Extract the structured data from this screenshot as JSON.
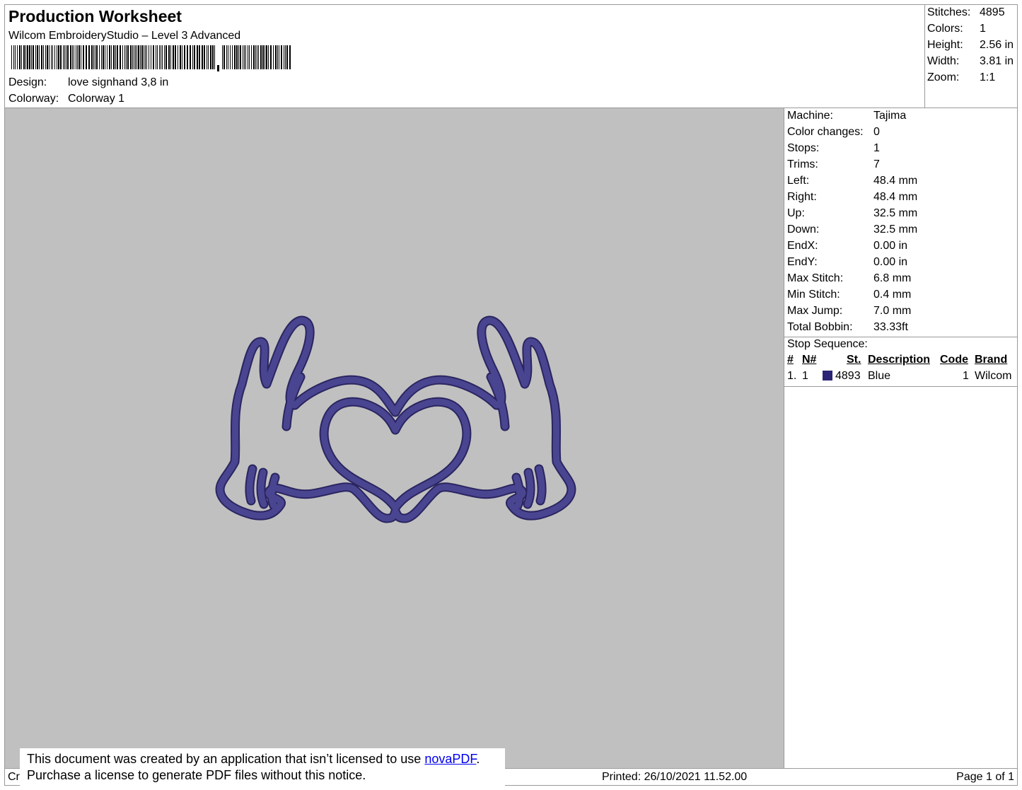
{
  "header": {
    "title": "Production Worksheet",
    "subtitle": "Wilcom EmbroideryStudio – Level 3 Advanced",
    "design_label": "Design:",
    "design_value": "love signhand 3,8 in",
    "colorway_label": "Colorway:",
    "colorway_value": "Colorway 1"
  },
  "summary": [
    {
      "label": "Stitches:",
      "value": "4895"
    },
    {
      "label": "Colors:",
      "value": "1"
    },
    {
      "label": "Height:",
      "value": "2.56 in"
    },
    {
      "label": "Width:",
      "value": "3.81 in"
    },
    {
      "label": "Zoom:",
      "value": "1:1"
    }
  ],
  "details": [
    {
      "label": "Machine:",
      "value": "Tajima"
    },
    {
      "label": "Color changes:",
      "value": "0"
    },
    {
      "label": "Stops:",
      "value": "1"
    },
    {
      "label": "Trims:",
      "value": "7"
    },
    {
      "label": "Left:",
      "value": "48.4 mm"
    },
    {
      "label": "Right:",
      "value": "48.4 mm"
    },
    {
      "label": "Up:",
      "value": "32.5 mm"
    },
    {
      "label": "Down:",
      "value": "32.5 mm"
    },
    {
      "label": "EndX:",
      "value": "0.00 in"
    },
    {
      "label": "EndY:",
      "value": "0.00 in"
    },
    {
      "label": "Max Stitch:",
      "value": "6.8 mm"
    },
    {
      "label": "Min Stitch:",
      "value": "0.4 mm"
    },
    {
      "label": "Max Jump:",
      "value": "7.0 mm"
    },
    {
      "label": "Total Bobbin:",
      "value": "33.33ft"
    }
  ],
  "stop_sequence": {
    "title": "Stop Sequence:",
    "columns": [
      "#",
      "N#",
      "St.",
      "Description",
      "Code",
      "Brand"
    ],
    "rows": [
      {
        "index": "1.",
        "n": "1",
        "color": "#2b2375",
        "stitches": "4893",
        "description": "Blue",
        "code": "1",
        "brand": "Wilcom"
      }
    ]
  },
  "design": {
    "thread_color": "#4a4590",
    "background_color": "#c0c0c0"
  },
  "footer": {
    "left_text": "Cr",
    "printed": "Printed: 26/10/2021 11.52.00",
    "page": "Page 1 of 1"
  },
  "notice": {
    "line1_pre": "This document was created by an application that isn’t licensed to use ",
    "link": "novaPDF",
    "line1_post": ".",
    "line2": "Purchase a license to generate PDF files without this notice."
  }
}
